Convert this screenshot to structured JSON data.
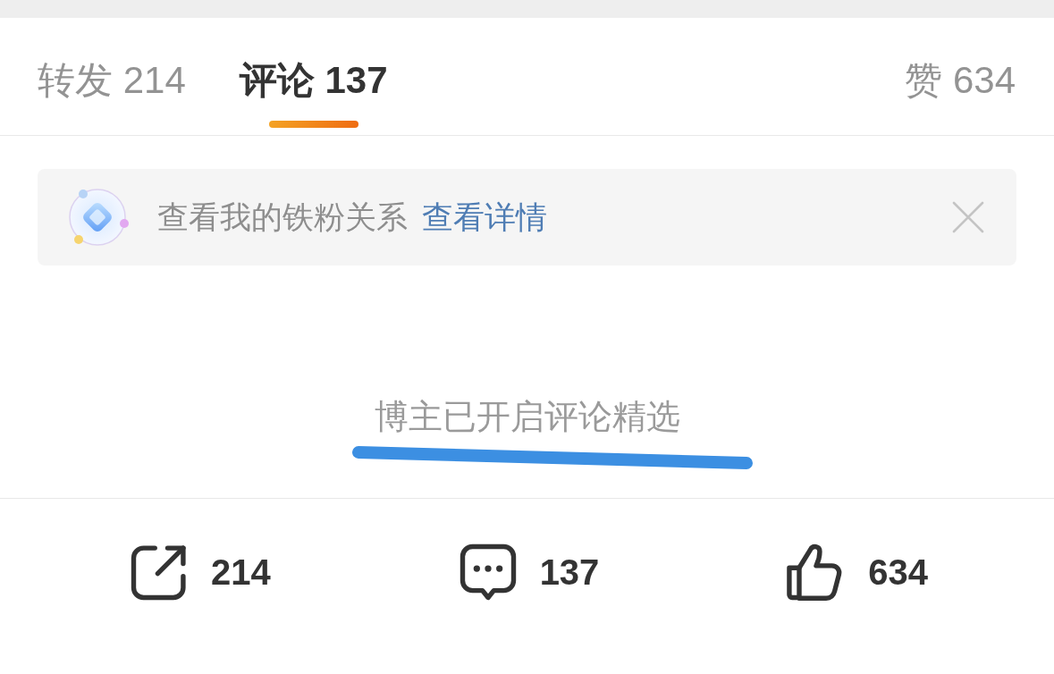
{
  "tabs": [
    {
      "label": "转发 214",
      "selected": false
    },
    {
      "label": "评论 137",
      "selected": true
    },
    {
      "label": "赞 634",
      "selected": false
    }
  ],
  "fan_banner": {
    "text": "查看我的铁粉关系",
    "link": "查看详情"
  },
  "notice": {
    "text": "博主已开启评论精选"
  },
  "action_bar": [
    {
      "kind": "share",
      "count": "214"
    },
    {
      "kind": "comment",
      "count": "137"
    },
    {
      "kind": "like",
      "count": "634"
    }
  ]
}
